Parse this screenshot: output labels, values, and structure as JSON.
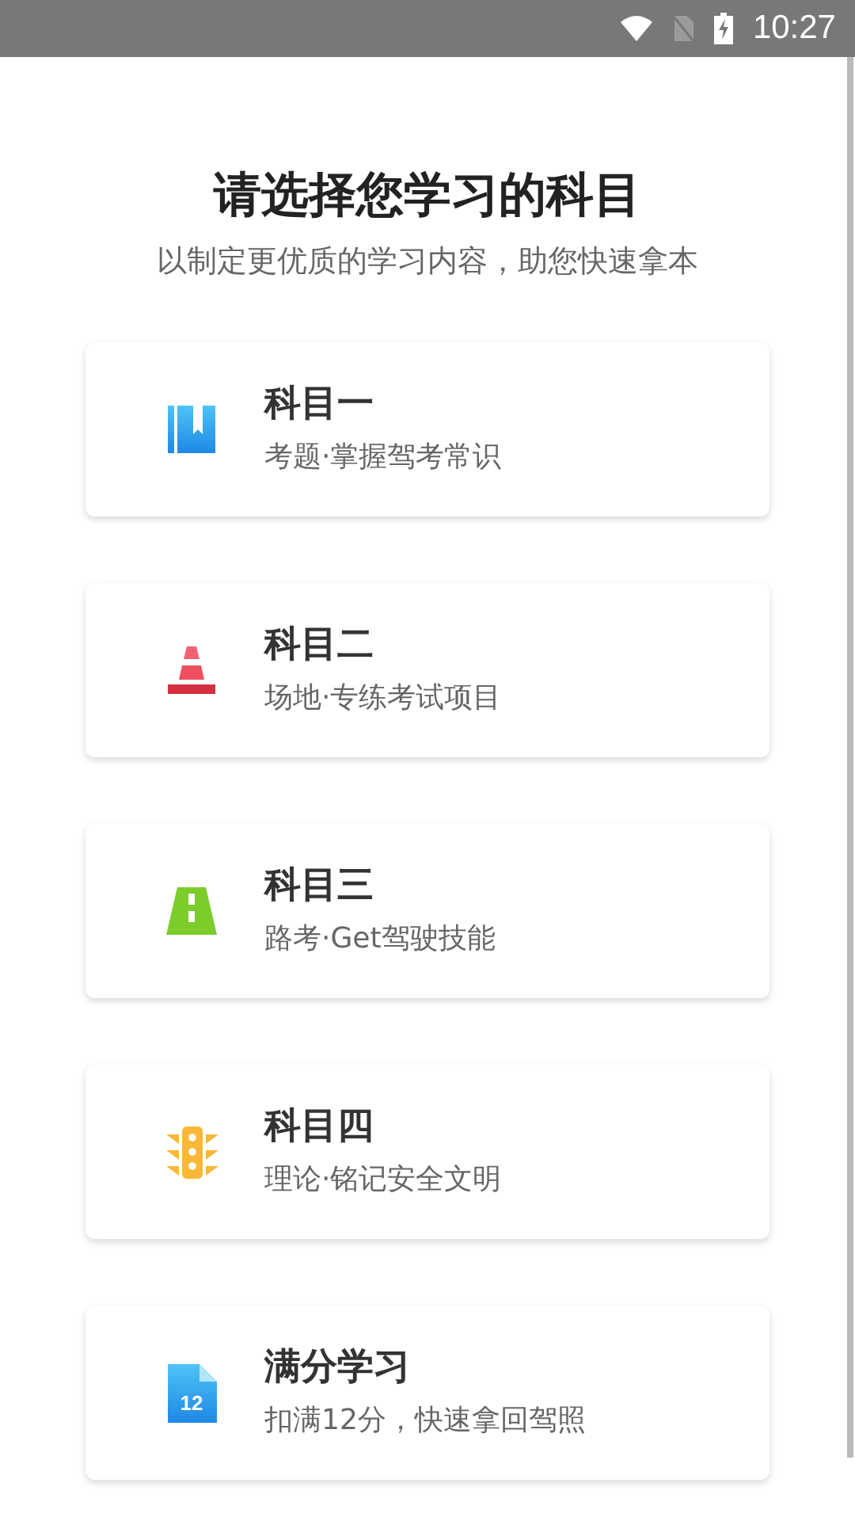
{
  "status_bar": {
    "time": "10:27"
  },
  "header": {
    "title": "请选择您学习的科目",
    "subtitle": "以制定更优质的学习内容，助您快速拿本"
  },
  "subjects": [
    {
      "kind": "book",
      "title": "科目一",
      "description": "考题·掌握驾考常识"
    },
    {
      "kind": "cone",
      "title": "科目二",
      "description": "场地·专练考试项目"
    },
    {
      "kind": "road",
      "title": "科目三",
      "description": "路考·Get驾驶技能"
    },
    {
      "kind": "light",
      "title": "科目四",
      "description": "理论·铭记安全文明"
    },
    {
      "kind": "document",
      "title": "满分学习",
      "description": "扣满12分，快速拿回驾照",
      "icon_text": "12"
    }
  ]
}
